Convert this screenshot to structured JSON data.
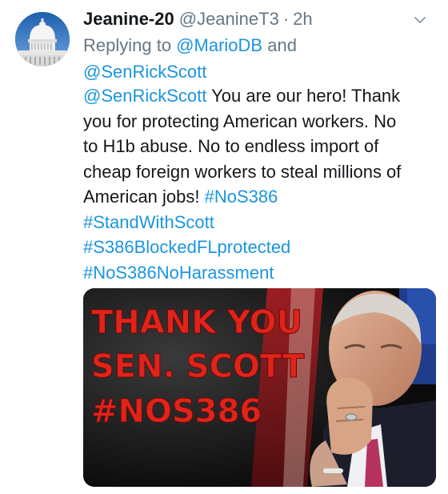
{
  "tweet": {
    "display_name": "Jeanine-20",
    "handle": "@JeanineT3",
    "separator": "·",
    "time": "2h",
    "reply_prefix": "Replying to",
    "reply_to_1": "@MarioDB",
    "reply_and": "and",
    "reply_to_2": "@SenRickScott",
    "body": {
      "mention": "@SenRickScott",
      "line1_rest": " You are our hero! Thank",
      "line2": "you for protecting American workers. No",
      "line3": "to H1b abuse. No to endless import of",
      "line4": "cheap foreign workers to steal millions of",
      "line5_text": "American jobs! ",
      "hashtag_1": "#NoS386",
      "hashtag_2": "#StandWithScott",
      "hashtag_3": "#S386BlockedFLprotected",
      "hashtag_4": "#NoS386NoHarassment"
    },
    "media": {
      "line1": "THANK YOU",
      "line2": "SEN. SCOTT",
      "line3": "#NOS386",
      "text_color": "#e0241b"
    }
  },
  "colors": {
    "link": "#1b95e0",
    "secondary": "#657786",
    "primary": "#14171a"
  }
}
